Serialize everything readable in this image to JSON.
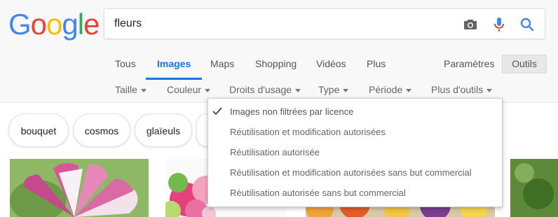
{
  "logo": {
    "letters": [
      "G",
      "o",
      "o",
      "g",
      "l",
      "e"
    ],
    "colors": [
      "#4285F4",
      "#EA4335",
      "#FBBC05",
      "#4285F4",
      "#34A853",
      "#EA4335"
    ]
  },
  "search": {
    "query": "fleurs"
  },
  "icons": {
    "camera": "camera-icon",
    "mic": "microphone-icon",
    "search": "search-icon"
  },
  "tabs": [
    {
      "label": "Tous"
    },
    {
      "label": "Images",
      "active": true
    },
    {
      "label": "Maps"
    },
    {
      "label": "Shopping"
    },
    {
      "label": "Vidéos"
    },
    {
      "label": "Plus"
    }
  ],
  "right_tabs": {
    "settings": "Paramètres",
    "tools": "Outils"
  },
  "filters": [
    {
      "label": "Taille"
    },
    {
      "label": "Couleur"
    },
    {
      "label": "Droits d'usage"
    },
    {
      "label": "Type"
    },
    {
      "label": "Période"
    },
    {
      "label": "Plus d'outils"
    }
  ],
  "chips": [
    {
      "label": "bouquet"
    },
    {
      "label": "cosmos"
    },
    {
      "label": "glaïeuls"
    }
  ],
  "usage_menu": {
    "items": [
      {
        "label": "Images non filtrées par licence",
        "selected": true
      },
      {
        "label": "Réutilisation et modification autorisées"
      },
      {
        "label": "Réutilisation autorisée"
      },
      {
        "label": "Réutilisation et modification autorisées sans but commercial"
      },
      {
        "label": "Réutilisation autorisée sans but commercial"
      }
    ]
  },
  "accent_color": "#1a73e8"
}
